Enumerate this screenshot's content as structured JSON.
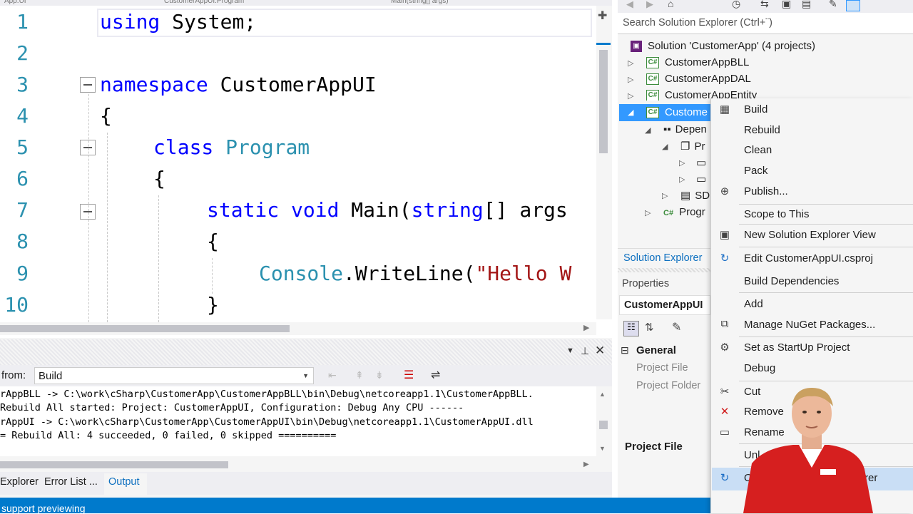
{
  "editor": {
    "tabs": [
      "App.UI",
      "CustomerAppUI.Program",
      "Main(string[] args)"
    ],
    "lines": [
      {
        "num": "1",
        "parts": [
          {
            "t": "using",
            "c": "kw"
          },
          {
            "t": " System;",
            "c": ""
          }
        ]
      },
      {
        "num": "2",
        "parts": []
      },
      {
        "num": "3",
        "parts": [
          {
            "t": "namespace",
            "c": "kw"
          },
          {
            "t": " CustomerAppUI",
            "c": ""
          }
        ]
      },
      {
        "num": "4",
        "parts": [
          {
            "t": "{",
            "c": ""
          }
        ]
      },
      {
        "num": "5",
        "parts": [
          {
            "t": "class",
            "c": "kw"
          },
          {
            "t": " ",
            "c": ""
          },
          {
            "t": "Program",
            "c": "ty"
          }
        ]
      },
      {
        "num": "6",
        "parts": [
          {
            "t": "{",
            "c": ""
          }
        ]
      },
      {
        "num": "7",
        "parts": [
          {
            "t": "static",
            "c": "kw"
          },
          {
            "t": " ",
            "c": ""
          },
          {
            "t": "void",
            "c": "kw"
          },
          {
            "t": " Main(",
            "c": ""
          },
          {
            "t": "string",
            "c": "kw"
          },
          {
            "t": "[] args",
            "c": ""
          }
        ]
      },
      {
        "num": "8",
        "parts": [
          {
            "t": "{",
            "c": ""
          }
        ]
      },
      {
        "num": "9",
        "parts": [
          {
            "t": "Console",
            "c": "ty"
          },
          {
            "t": ".WriteLine(",
            "c": ""
          },
          {
            "t": "\"Hello W",
            "c": "st"
          }
        ]
      },
      {
        "num": "10",
        "parts": [
          {
            "t": "}",
            "c": ""
          }
        ]
      }
    ]
  },
  "output": {
    "show_from_label": "from:",
    "show_from_value": "Build",
    "lines": [
      "rAppBLL -> C:\\work\\cSharp\\CustomerApp\\CustomerAppBLL\\bin\\Debug\\netcoreapp1.1\\CustomerAppBLL.",
      "Rebuild All started: Project: CustomerAppUI, Configuration: Debug Any CPU ------",
      "rAppUI -> C:\\work\\cSharp\\CustomerApp\\CustomerAppUI\\bin\\Debug\\netcoreapp1.1\\CustomerAppUI.dll",
      "= Rebuild All: 4 succeeded, 0 failed, 0 skipped =========="
    ],
    "tabs": [
      "Explorer",
      "Error List ...",
      "Output"
    ],
    "status": "support previewing"
  },
  "solution_explorer": {
    "search_placeholder": "Search Solution Explorer (Ctrl+¨)",
    "solution": "Solution 'CustomerApp' (4 projects)",
    "projects": [
      "CustomerAppBLL",
      "CustomerAppDAL",
      "CustomerAppEntity",
      "Custome"
    ],
    "sub_items": [
      "Depen",
      "Pr",
      "SD",
      "Progr"
    ],
    "footer_tab": "Solution Explorer"
  },
  "properties": {
    "title": "Properties",
    "object": "CustomerAppUI",
    "category": "General",
    "rows": [
      "Project File",
      "Project Folder"
    ],
    "desc_title": "Project File"
  },
  "context_menu": {
    "items": [
      {
        "label": "Build",
        "icon": "build-icon"
      },
      {
        "label": "Rebuild",
        "icon": ""
      },
      {
        "label": "Clean",
        "icon": ""
      },
      {
        "label": "Pack",
        "icon": ""
      },
      {
        "label": "Publish...",
        "icon": "globe-icon"
      },
      {
        "label": "Scope to This",
        "icon": ""
      },
      {
        "label": "New Solution Explorer View",
        "icon": "window-icon"
      },
      {
        "label": "Edit CustomerAppUI.csproj",
        "icon": "redo-icon"
      },
      {
        "label": "Build Dependencies",
        "icon": ""
      },
      {
        "label": "Add",
        "icon": ""
      },
      {
        "label": "Manage NuGet Packages...",
        "icon": "package-icon"
      },
      {
        "label": "Set as StartUp Project",
        "icon": "gear-icon"
      },
      {
        "label": "Debug",
        "icon": ""
      },
      {
        "label": "Cut",
        "icon": "scissors-icon"
      },
      {
        "label": "Remove",
        "icon": "x-icon"
      },
      {
        "label": "Rename",
        "icon": "rename-icon"
      },
      {
        "label": "Unl",
        "icon": ""
      },
      {
        "label": "O",
        "icon": "redo-icon"
      },
      {
        "label": "rer",
        "icon": ""
      }
    ]
  },
  "colors": {
    "keyword": "#0000ff",
    "type": "#2b91af",
    "string": "#a31515",
    "accent": "#007acc",
    "selection": "#3399ff"
  }
}
